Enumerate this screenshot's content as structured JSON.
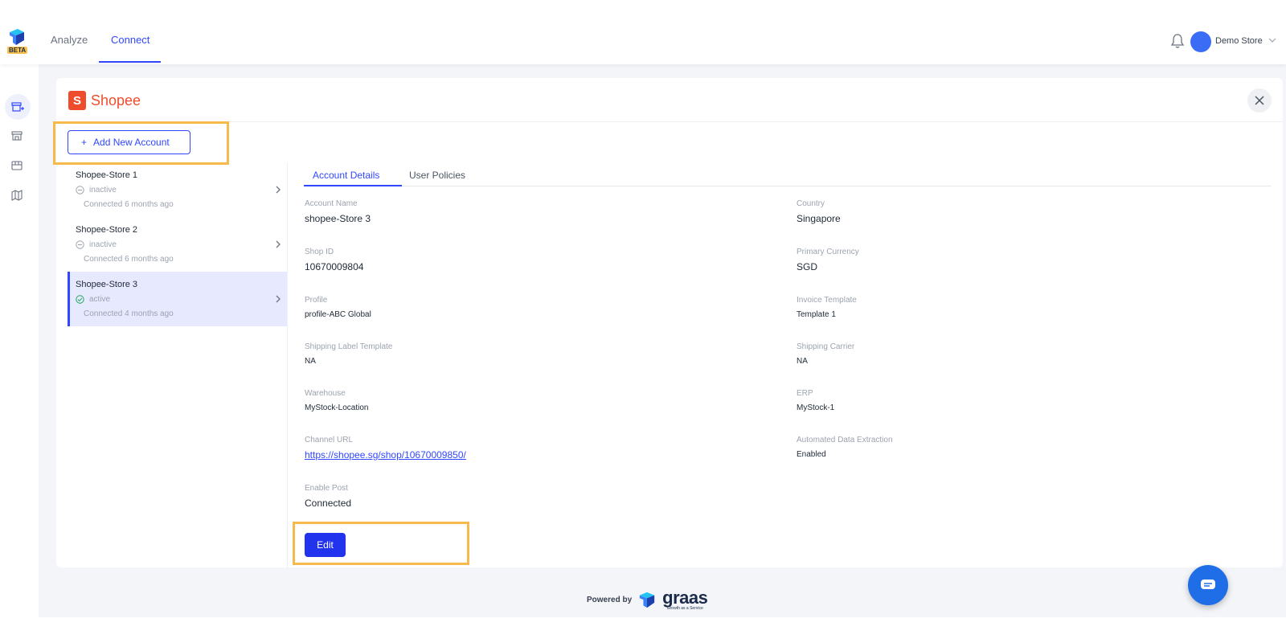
{
  "topbar": {
    "beta_badge": "BETA",
    "nav": [
      {
        "label": "Analyze",
        "active": false
      },
      {
        "label": "Connect",
        "active": true
      }
    ],
    "store_name": "Demo Store",
    "accent_color": "#3047ff"
  },
  "sidebar": {
    "icons": [
      "store-plus-icon",
      "storefront-icon",
      "warehouse-icon",
      "map-icon"
    ]
  },
  "channel": {
    "name": "Shopee",
    "brand_color": "#ee4d2d",
    "close_icon": "close-icon"
  },
  "add_account_label": "Add New Account",
  "accounts": [
    {
      "name": "Shopee-Store 1",
      "status": "inactive",
      "connected": "Connected  6 months ago",
      "selected": false
    },
    {
      "name": "Shopee-Store 2",
      "status": "inactive",
      "connected": "Connected  6 months ago",
      "selected": false
    },
    {
      "name": "Shopee-Store 3",
      "status": "active",
      "connected": "Connected  4 months ago",
      "selected": true
    }
  ],
  "tabs": [
    {
      "label": "Account Details",
      "active": true
    },
    {
      "label": "User Policies",
      "active": false
    }
  ],
  "details": {
    "account_name": {
      "label": "Account Name",
      "value": "shopee-Store 3"
    },
    "country": {
      "label": "Country",
      "value": "Singapore"
    },
    "shop_id": {
      "label": "Shop ID",
      "value": "10670009804"
    },
    "primary_currency": {
      "label": "Primary Currency",
      "value": "SGD"
    },
    "profile": {
      "label": "Profile",
      "value": "profile-ABC Global"
    },
    "invoice_template": {
      "label": "Invoice Template",
      "value": "Template 1"
    },
    "shipping_label_template": {
      "label": "Shipping Label Template",
      "value": "NA"
    },
    "shipping_carrier": {
      "label": "Shipping Carrier",
      "value": "NA"
    },
    "warehouse": {
      "label": "Warehouse",
      "value": "MyStock-Location"
    },
    "erp": {
      "label": "ERP",
      "value": "MyStock-1"
    },
    "channel_url": {
      "label": "Channel URL",
      "value": "https://shopee.sg/shop/10670009850/"
    },
    "automated_data_extraction": {
      "label": "Automated Data Extraction",
      "value": "Enabled"
    },
    "enable_post": {
      "label": "Enable Post",
      "value": "Connected"
    }
  },
  "edit_label": "Edit",
  "footer": {
    "powered_by": "Powered by",
    "brand": "graas",
    "tagline": "Growth as a Service"
  },
  "highlight_color": "#f6b94b"
}
